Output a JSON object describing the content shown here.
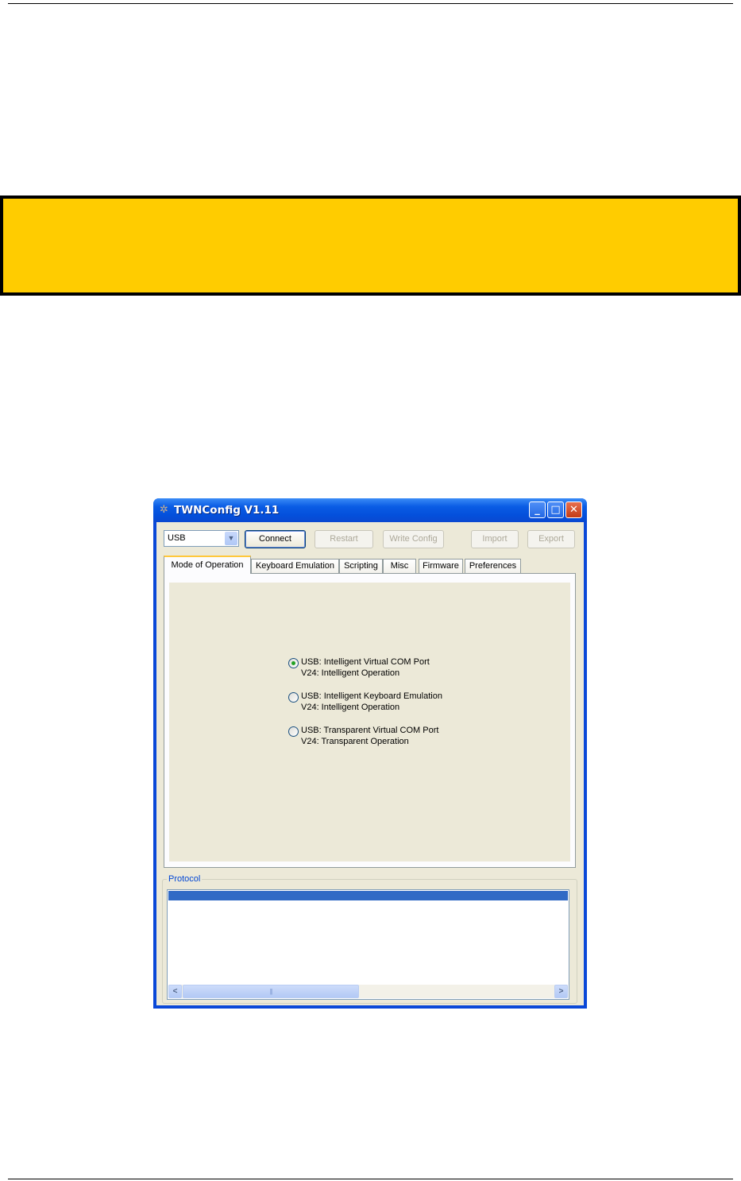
{
  "window": {
    "title": "TWNConfig V1.11",
    "controls": {
      "minimize": "minimize-icon",
      "maximize": "maximize-icon",
      "close": "close-icon"
    }
  },
  "toolbar": {
    "port_select": {
      "value": "USB"
    },
    "connect_label": "Connect",
    "restart_label": "Restart",
    "write_config_label": "Write Config",
    "import_label": "Import",
    "export_label": "Export"
  },
  "tabs": [
    {
      "label": "Mode of Operation",
      "active": true
    },
    {
      "label": "Keyboard Emulation"
    },
    {
      "label": "Scripting"
    },
    {
      "label": "Misc"
    },
    {
      "label": "Firmware"
    },
    {
      "label": "Preferences"
    }
  ],
  "mode_options": [
    {
      "line1": "USB: Intelligent Virtual COM Port",
      "line2": "V24: Intelligent Operation",
      "selected": true
    },
    {
      "line1": "USB: Intelligent Keyboard Emulation",
      "line2": "V24: Intelligent Operation",
      "selected": false
    },
    {
      "line1": "USB: Transparent Virtual COM Port",
      "line2": "V24: Transparent Operation",
      "selected": false
    }
  ],
  "protocol": {
    "label": "Protocol",
    "thumb_grip": "|||"
  },
  "colors": {
    "warning_box": "#ffcc00",
    "titlebar": "#0a5ce4",
    "window_face": "#ece9d8",
    "selection": "#316ac5"
  }
}
